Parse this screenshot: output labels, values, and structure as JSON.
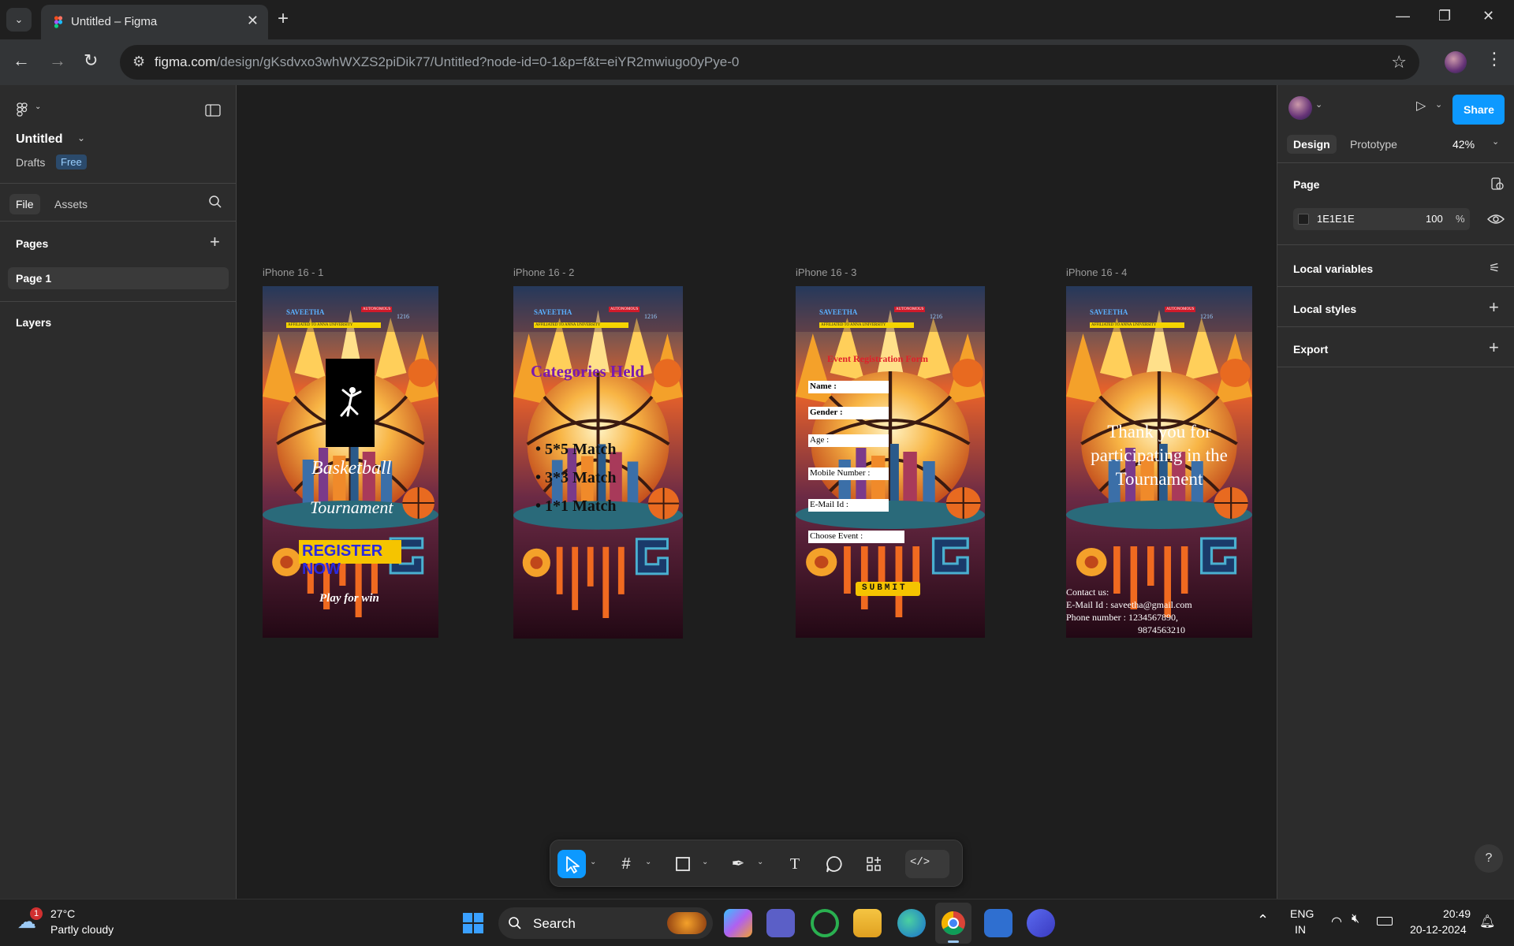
{
  "browser": {
    "tab_title": "Untitled – Figma",
    "url_host": "figma.com",
    "url_path": "/design/gKsdvxo3whWXZS2piDik77/Untitled?node-id=0-1&p=f&t=eiYR2mwiugo0yPye-0"
  },
  "left_panel": {
    "file_name": "Untitled",
    "drafts_label": "Drafts",
    "plan_badge": "Free",
    "tabs": [
      "File",
      "Assets"
    ],
    "pages_heading": "Pages",
    "pages": [
      "Page 1"
    ],
    "layers_heading": "Layers"
  },
  "canvas": {
    "frames": [
      {
        "label": "iPhone 16 - 1"
      },
      {
        "label": "iPhone 16 - 2"
      },
      {
        "label": "iPhone 16 - 3"
      },
      {
        "label": "iPhone 16 - 4"
      }
    ],
    "frame1": {
      "line1": "Basketball",
      "line2": "Tournament",
      "cta": "REGISTER NOW",
      "tagline": "Play for win"
    },
    "frame2": {
      "title": "Categories Held",
      "items": [
        "5*5 Match",
        "3*3 Match",
        "1*1 Match"
      ]
    },
    "frame3": {
      "title": "Event Registration Form",
      "fields": [
        "Name :",
        "Gender :",
        "Age :",
        "Mobile Number :",
        "E-Mail Id :",
        "Choose Event :"
      ],
      "submit": "SUBMIT"
    },
    "frame4": {
      "thanks": "Thank you for participating in the Tournament",
      "contact_heading": "Contact us:",
      "email_line": "E-Mail Id : saveetha@gmail.com",
      "phone_line": "Phone number : 1234567890,",
      "phone_line2": "9874563210"
    },
    "header_badge": {
      "college": "SAVEETHA",
      "badge": "AUTONOMOUS",
      "code_label": "TNEA CODE",
      "code": "1216",
      "affiliation": "AFFILIATED TO ANNA UNIVERSITY"
    }
  },
  "right_panel": {
    "tabs": [
      "Design",
      "Prototype"
    ],
    "zoom": "42%",
    "share_label": "Share",
    "page_heading": "Page",
    "bg_color_hex": "1E1E1E",
    "opacity": "100",
    "opacity_unit": "%",
    "sections": [
      "Local variables",
      "Local styles",
      "Export"
    ]
  },
  "taskbar": {
    "temperature": "27°C",
    "weather": "Partly cloudy",
    "weather_badge": "1",
    "search_label": "Search",
    "lang1": "ENG",
    "lang2": "IN",
    "time": "20:49",
    "date": "20-12-2024"
  },
  "colors": {
    "accent": "#0d99ff",
    "canvas_bg": "#1e1e1e",
    "panel_bg": "#2c2c2c"
  }
}
